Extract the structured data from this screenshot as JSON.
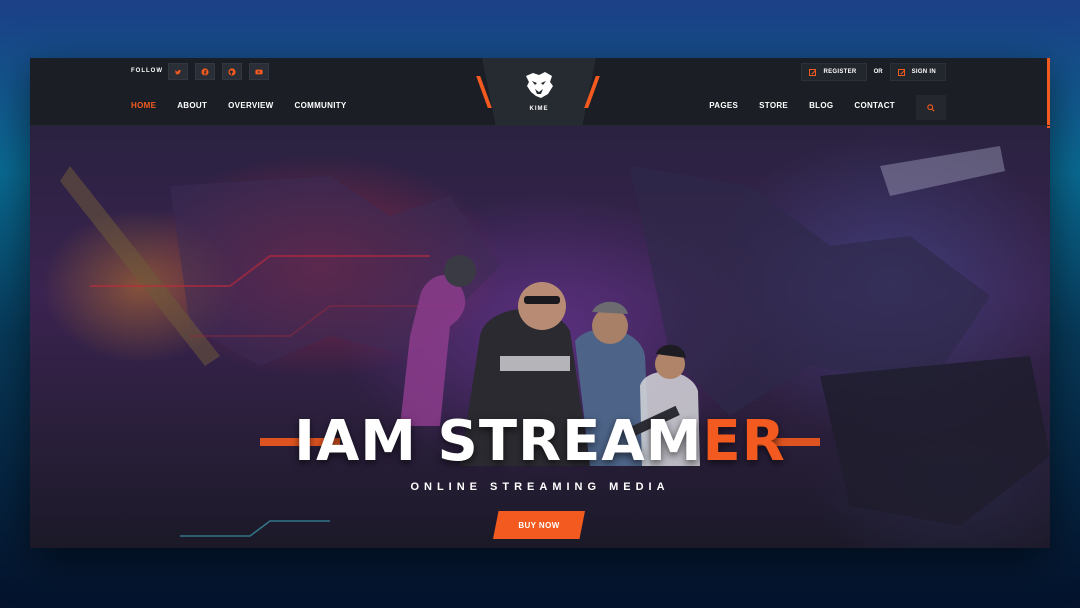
{
  "header": {
    "follow_label": "FOLLOW",
    "social": [
      {
        "icon": "twitter-icon"
      },
      {
        "icon": "facebook-icon"
      },
      {
        "icon": "github-icon"
      },
      {
        "icon": "youtube-icon"
      }
    ],
    "logo_text": "KIME",
    "nav_left": [
      "HOME",
      "ABOUT",
      "OVERVIEW",
      "COMMUNITY"
    ],
    "nav_right": [
      "PAGES",
      "STORE",
      "BLOG",
      "CONTACT"
    ],
    "active_nav": "HOME",
    "register_label": "REGISTER",
    "or_label": "OR",
    "signin_label": "SIGN IN",
    "search_icon": "search-icon"
  },
  "hero": {
    "title_white": "IAM STREAM",
    "title_orange": "ER",
    "subtitle": "ONLINE STREAMING MEDIA",
    "cta_label": "BUY NOW"
  },
  "colors": {
    "accent": "#f25a1f",
    "header_bg": "#1b1e24",
    "text": "#ffffff"
  }
}
